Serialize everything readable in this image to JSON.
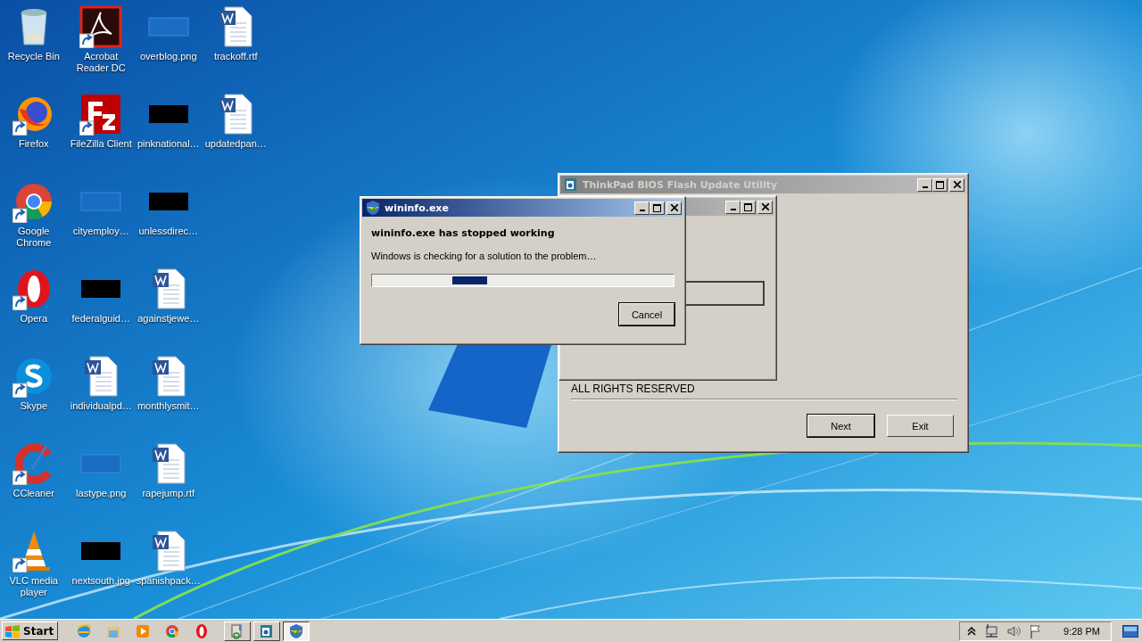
{
  "desktop": {
    "icons": [
      {
        "label": "Recycle Bin",
        "kind": "recycle",
        "shortcut": false
      },
      {
        "label": "Firefox",
        "kind": "firefox",
        "shortcut": true
      },
      {
        "label": "Google Chrome",
        "kind": "chrome",
        "shortcut": true
      },
      {
        "label": "Opera",
        "kind": "opera",
        "shortcut": true
      },
      {
        "label": "Skype",
        "kind": "skype",
        "shortcut": true
      },
      {
        "label": "CCleaner",
        "kind": "ccleaner",
        "shortcut": true
      },
      {
        "label": "VLC media player",
        "kind": "vlc",
        "shortcut": true
      },
      {
        "label": "Acrobat Reader DC",
        "kind": "acrobat",
        "shortcut": true
      },
      {
        "label": "FileZilla Client",
        "kind": "filezilla",
        "shortcut": true
      },
      {
        "label": "cityemploy…",
        "kind": "image-light",
        "shortcut": false
      },
      {
        "label": "federalguid…",
        "kind": "image-dark",
        "shortcut": false
      },
      {
        "label": "individualpd…",
        "kind": "word",
        "shortcut": false
      },
      {
        "label": "lastype.png",
        "kind": "image-light",
        "shortcut": false
      },
      {
        "label": "nextsouth.jpg",
        "kind": "image-dark",
        "shortcut": false
      },
      {
        "label": "overblog.png",
        "kind": "image-light",
        "shortcut": false
      },
      {
        "label": "pinknational…",
        "kind": "image-dark",
        "shortcut": false
      },
      {
        "label": "unlessdirec…",
        "kind": "image-dark",
        "shortcut": false
      },
      {
        "label": "againstjewe…",
        "kind": "word",
        "shortcut": false
      },
      {
        "label": "monthlysmit…",
        "kind": "word",
        "shortcut": false
      },
      {
        "label": "rapejump.rtf",
        "kind": "word",
        "shortcut": false
      },
      {
        "label": "spanishpack…",
        "kind": "word",
        "shortcut": false
      },
      {
        "label": "trackoff.rtf",
        "kind": "word",
        "shortcut": false
      },
      {
        "label": "updatedpan…",
        "kind": "word",
        "shortcut": false
      }
    ]
  },
  "bios_window": {
    "title": "ThinkPad BIOS Flash Update Utility",
    "active": false,
    "child_window": {
      "active": false
    },
    "footer_text": "ALL RIGHTS RESERVED",
    "buttons": [
      {
        "label": "Next",
        "default": true
      },
      {
        "label": "Exit",
        "default": false
      }
    ]
  },
  "error_dialog": {
    "title": "wininfo.exe",
    "active": true,
    "heading": "wininfo.exe has stopped working",
    "message": "Windows is checking for a solution to the problem…",
    "button": "Cancel"
  },
  "taskbar": {
    "start_label": "Start",
    "quick_launch": [
      {
        "kind": "ie"
      },
      {
        "kind": "explorer"
      },
      {
        "kind": "media"
      },
      {
        "kind": "chrome"
      },
      {
        "kind": "opera"
      }
    ],
    "tasks": [
      {
        "kind": "setup",
        "selected": false
      },
      {
        "kind": "bios",
        "selected": false
      },
      {
        "kind": "wininfo",
        "selected": true
      }
    ],
    "clock": "9:28 PM"
  }
}
